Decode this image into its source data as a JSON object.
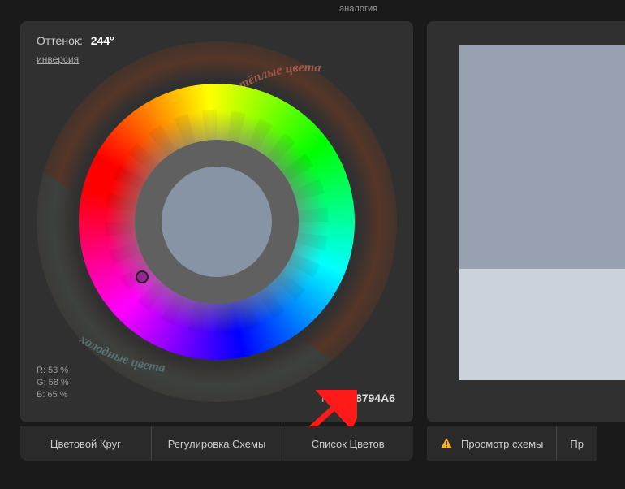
{
  "header": {
    "mode_label": "аналогия"
  },
  "wheel_panel": {
    "hue_label": "Оттенок:",
    "hue_value": "244°",
    "invert_label": "инверсия",
    "warm_label": "тёплые цвета",
    "cold_label": "холодные цвета",
    "rgb_percent": {
      "r_label": "R: 53 %",
      "g_label": "G: 58 %",
      "b_label": "B: 65 %"
    },
    "rgb_hex_label": "RGB:",
    "rgb_hex_value": "8794A6",
    "selected_color": "#8794A6"
  },
  "tabs_left": {
    "wheel": "Цветовой Круг",
    "adjust": "Регулировка Схемы",
    "list": "Список Цветов"
  },
  "preview": {
    "swatches": [
      "#98a1b0",
      "#98a1b0",
      "#cbd2d9"
    ]
  },
  "tabs_right": {
    "view": "Просмотр схемы",
    "next": "Пр"
  }
}
